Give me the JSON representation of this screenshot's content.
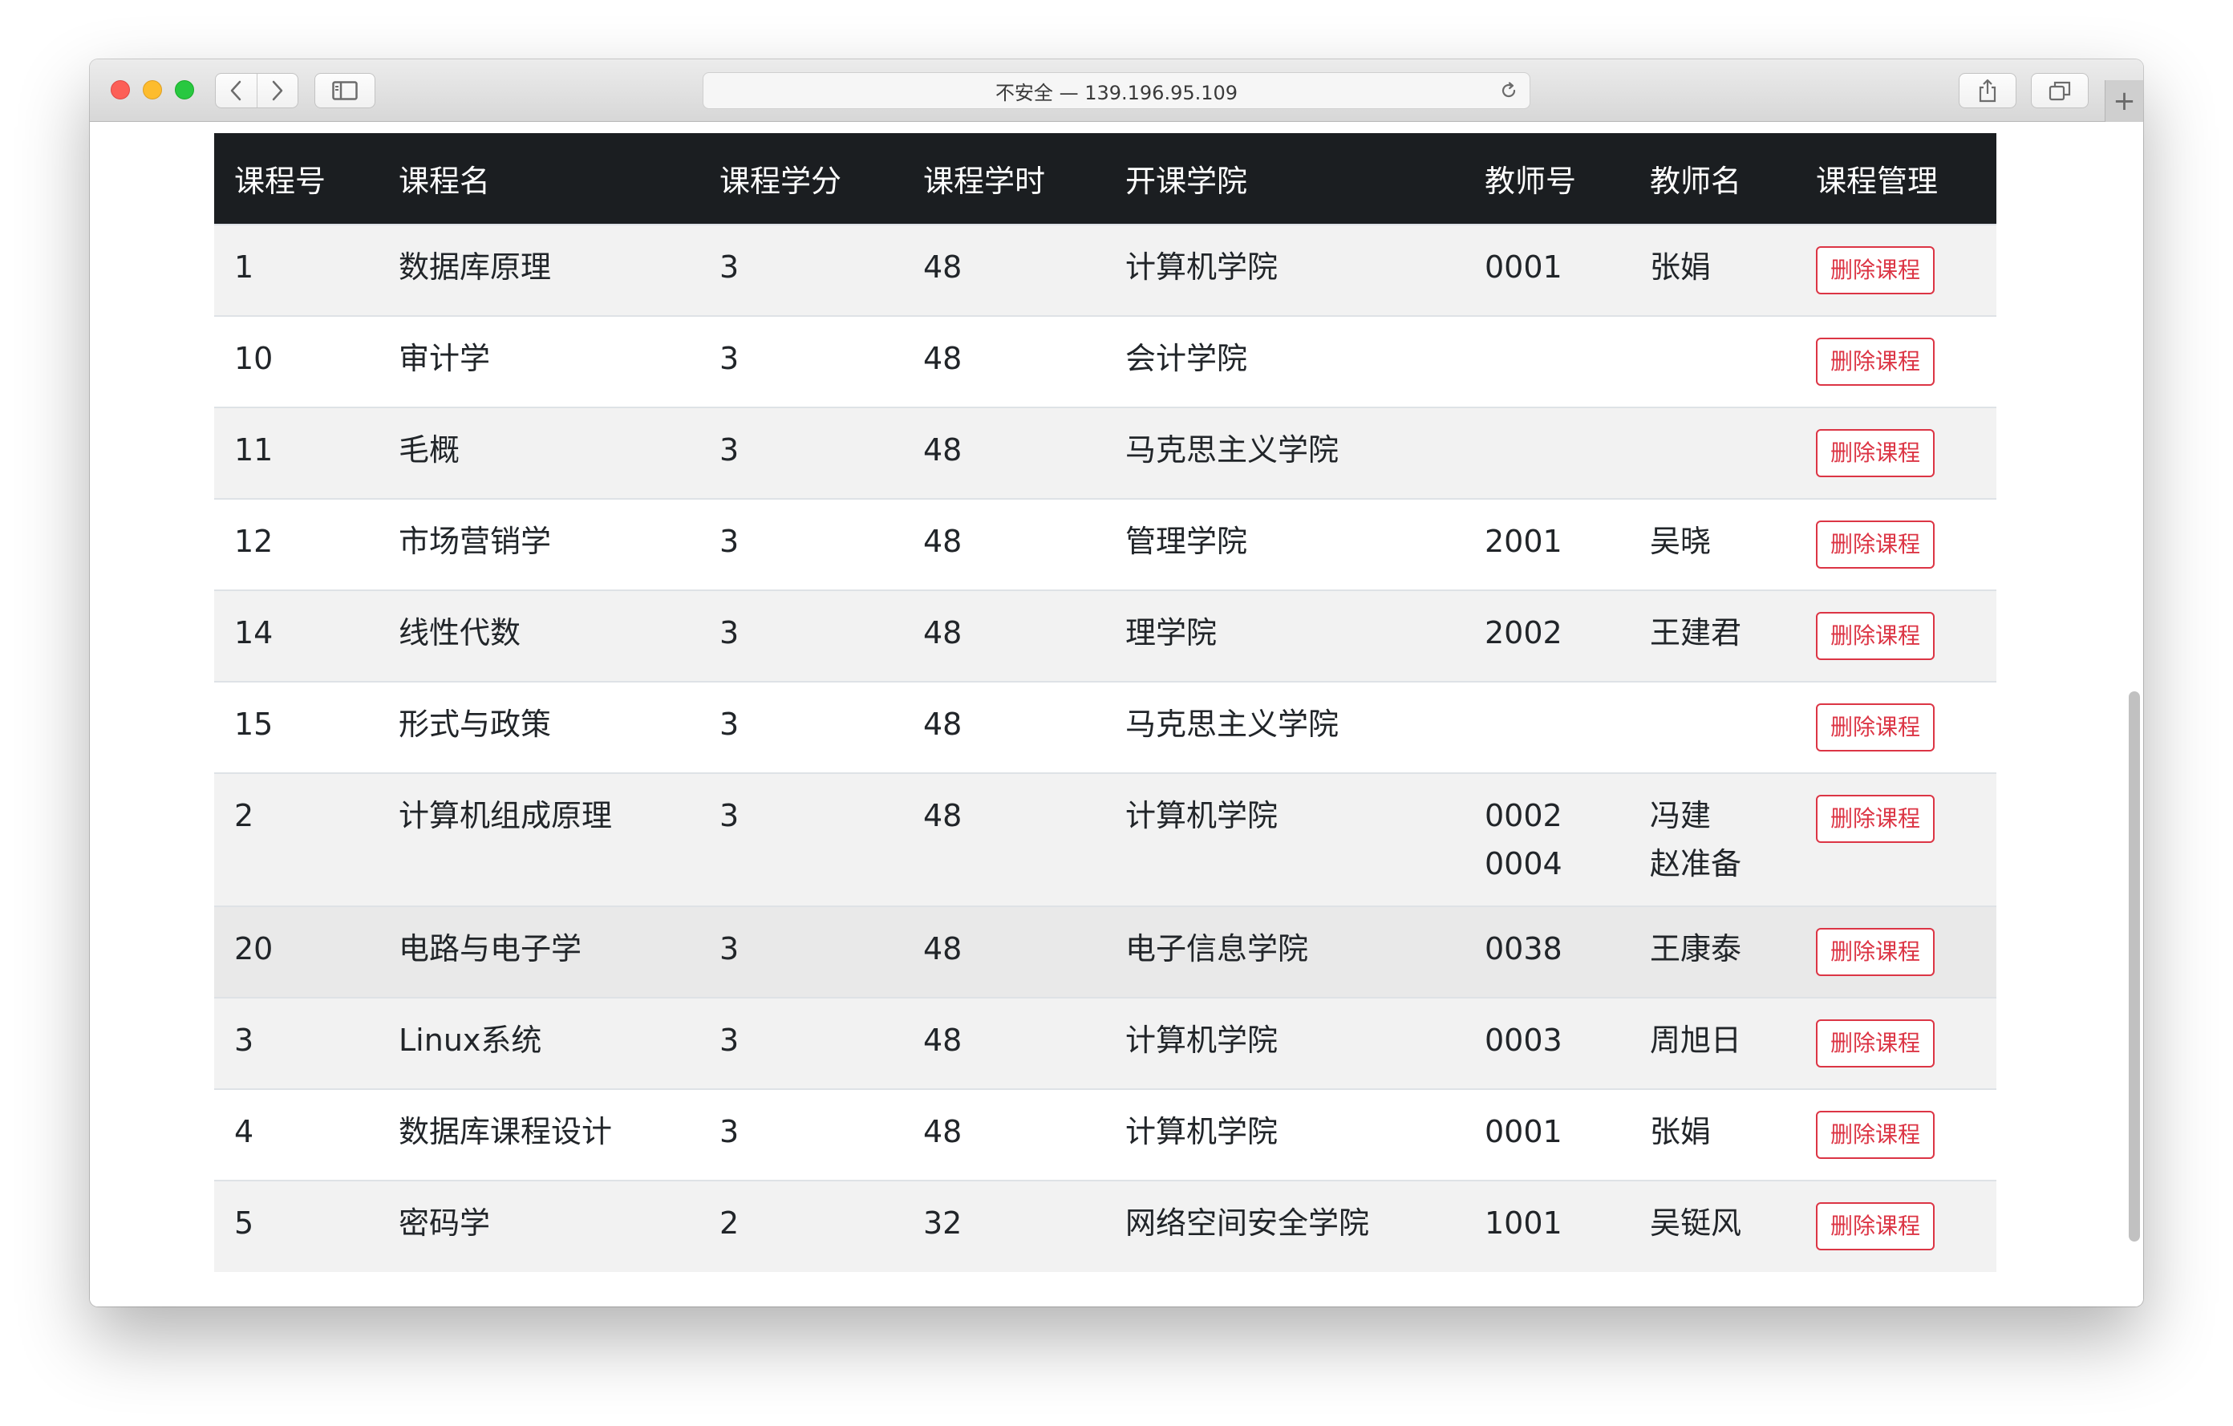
{
  "browser": {
    "address": "不安全 — 139.196.95.109",
    "new_tab_label": "+"
  },
  "table": {
    "headers": [
      "课程号",
      "课程名",
      "课程学分",
      "课程学时",
      "开课学院",
      "教师号",
      "教师名",
      "课程管理"
    ],
    "delete_label": "删除课程",
    "rows": [
      {
        "id": "1",
        "name": "数据库原理",
        "credit": "3",
        "hours": "48",
        "college": "计算机学院",
        "teacher_ids": [
          "0001"
        ],
        "teacher_names": [
          "张娟"
        ]
      },
      {
        "id": "10",
        "name": "审计学",
        "credit": "3",
        "hours": "48",
        "college": "会计学院",
        "teacher_ids": [],
        "teacher_names": []
      },
      {
        "id": "11",
        "name": "毛概",
        "credit": "3",
        "hours": "48",
        "college": "马克思主义学院",
        "teacher_ids": [],
        "teacher_names": []
      },
      {
        "id": "12",
        "name": "市场营销学",
        "credit": "3",
        "hours": "48",
        "college": "管理学院",
        "teacher_ids": [
          "2001"
        ],
        "teacher_names": [
          "吴晓"
        ]
      },
      {
        "id": "14",
        "name": "线性代数",
        "credit": "3",
        "hours": "48",
        "college": "理学院",
        "teacher_ids": [
          "2002"
        ],
        "teacher_names": [
          "王建君"
        ]
      },
      {
        "id": "15",
        "name": "形式与政策",
        "credit": "3",
        "hours": "48",
        "college": "马克思主义学院",
        "teacher_ids": [],
        "teacher_names": []
      },
      {
        "id": "2",
        "name": "计算机组成原理",
        "credit": "3",
        "hours": "48",
        "college": "计算机学院",
        "teacher_ids": [
          "0002",
          "0004"
        ],
        "teacher_names": [
          "冯建",
          "赵准备"
        ]
      },
      {
        "id": "20",
        "name": "电路与电子学",
        "credit": "3",
        "hours": "48",
        "college": "电子信息学院",
        "teacher_ids": [
          "0038"
        ],
        "teacher_names": [
          "王康泰"
        ]
      },
      {
        "id": "3",
        "name": "Linux系统",
        "credit": "3",
        "hours": "48",
        "college": "计算机学院",
        "teacher_ids": [
          "0003"
        ],
        "teacher_names": [
          "周旭日"
        ]
      },
      {
        "id": "4",
        "name": "数据库课程设计",
        "credit": "3",
        "hours": "48",
        "college": "计算机学院",
        "teacher_ids": [
          "0001"
        ],
        "teacher_names": [
          "张娟"
        ]
      },
      {
        "id": "5",
        "name": "密码学",
        "credit": "2",
        "hours": "32",
        "college": "网络空间安全学院",
        "teacher_ids": [
          "1001"
        ],
        "teacher_names": [
          "吴铤风"
        ]
      }
    ]
  }
}
